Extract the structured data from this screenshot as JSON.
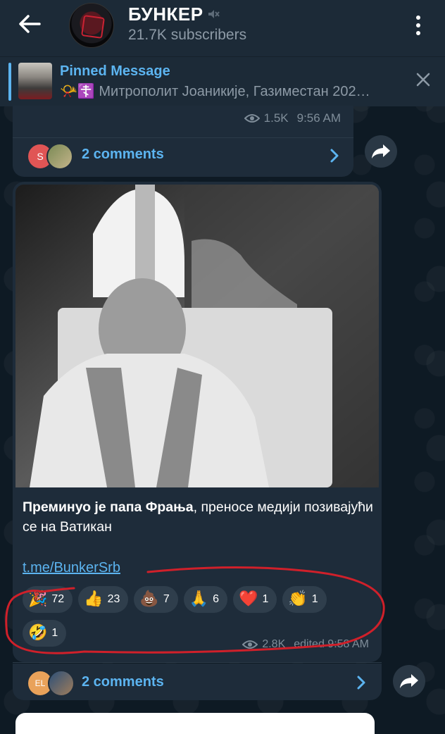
{
  "header": {
    "title": "БУНКЕР",
    "subscribers": "21.7K subscribers"
  },
  "pinned": {
    "title": "Pinned Message",
    "text": "📯☦️ Митрополит Јоаникије, Газиместан 202…"
  },
  "previous_post": {
    "views": "1.5K",
    "time": "9:56 AM",
    "avatar_letter": "S",
    "comments": "2 comments"
  },
  "post": {
    "caption_bold": "Преминуо је папа Фрања",
    "caption_rest": ", преносе медији позивајући се на Ватикан",
    "link": "t.me/BunkerSrb",
    "reactions": [
      {
        "emoji": "🎉",
        "count": "72"
      },
      {
        "emoji": "👍",
        "count": "23"
      },
      {
        "emoji": "💩",
        "count": "7"
      },
      {
        "emoji": "🙏",
        "count": "6"
      },
      {
        "emoji": "❤️",
        "count": "1"
      },
      {
        "emoji": "👏",
        "count": "1"
      },
      {
        "emoji": "🤣",
        "count": "1"
      }
    ],
    "views": "2.8K",
    "edited_time": "edited 9:58 AM",
    "avatar_letters": "EL",
    "comments": "2 comments"
  },
  "colors": {
    "accent": "#5cb4f0",
    "bubble": "#1e2c3a",
    "header": "#1c2a37",
    "annotation": "#d0202a"
  }
}
